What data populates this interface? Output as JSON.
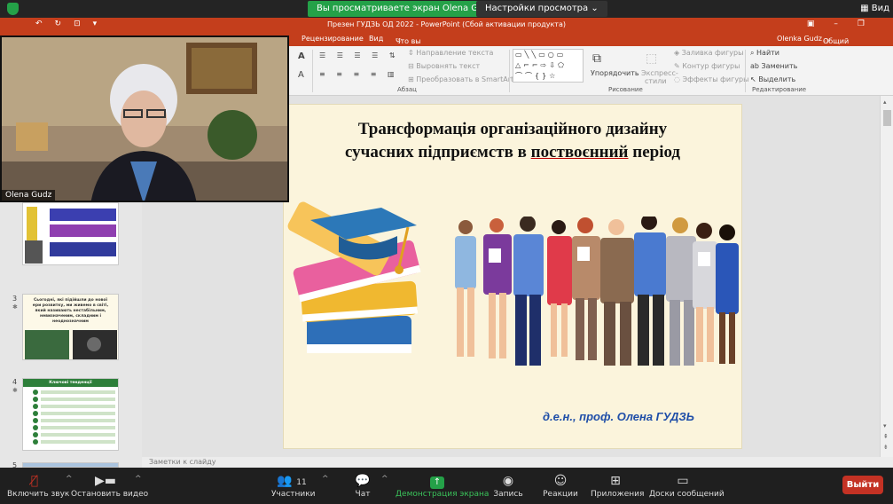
{
  "zoom_top": {
    "banner": "Вы просматриваете экран Olena Gudz",
    "view_options": "Настройки просмотра",
    "view_right": "Вид"
  },
  "ppt": {
    "doc_title": "Презен ГУДЗЬ ОД 2022 - PowerPoint (Сбой активации продукта)",
    "user": "Olenka Gudz",
    "tabs": {
      "review": "Рецензирование",
      "view": "Вид",
      "tell_me": "Что вы хотите сделать?",
      "share": "Общий доступ"
    },
    "ribbon": {
      "text_direction": "Направление текста",
      "align_text": "Выровнять текст",
      "smartart": "Преобразовать в SmartArt",
      "paragraph_group": "Абзац",
      "arrange": "Упорядочить",
      "quick_styles_1": "Экспресс-",
      "quick_styles_2": "стили",
      "shape_fill": "Заливка фигуры",
      "shape_outline": "Контур фигуры",
      "shape_effects": "Эффекты фигуры",
      "drawing_group": "Рисование",
      "find": "Найти",
      "replace": "Заменить",
      "select": "Выделить",
      "editing_group": "Редактирование"
    },
    "thumbnails": {
      "num3": "3",
      "num4": "4",
      "num5": "5",
      "slide3_text": "Сьогодні, які підійшли до нової ери розвитку, ми живемо в світі, який називають нестабільним, невизначеним, складним і неоднозначним",
      "slide4_title": "Ключові тенденції"
    },
    "slide": {
      "title_line1": "Трансформація організаційного дизайну",
      "title_line2a": "сучасних підприємств в ",
      "title_line2b": "поствоєнний",
      "title_line2c": " період",
      "author": "д.е.н., проф. Олена ГУДЗЬ"
    },
    "notes_placeholder": "Заметки к слайду"
  },
  "video": {
    "participant_name": "Olena Gudz"
  },
  "zoom_bar": {
    "mute": "Включить звук",
    "stop_video": "Остановить видео",
    "participants": "Участники",
    "participants_count": "11",
    "chat": "Чат",
    "share_screen": "Демонстрация экрана",
    "record": "Запись",
    "reactions": "Реакции",
    "apps": "Приложения",
    "whiteboards": "Доски сообщений",
    "leave": "Выйти"
  },
  "colors": {
    "ppt_accent": "#c43e1c",
    "zoom_green": "#24a148",
    "leave_red": "#c43224",
    "author_blue": "#1f4ea8"
  }
}
